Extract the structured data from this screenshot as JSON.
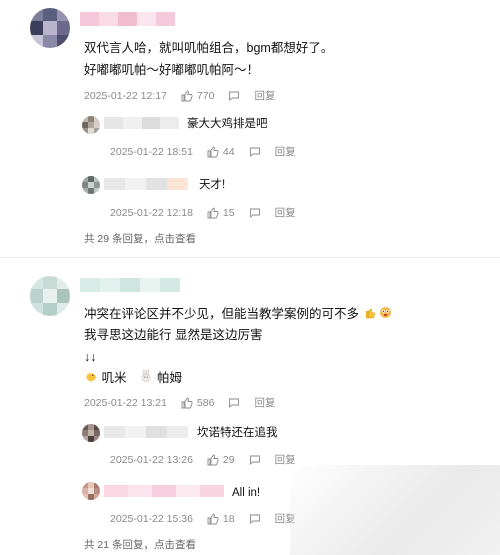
{
  "comments": [
    {
      "text_lines": [
        "双代言人哈，就叫叽帕组合，bgm都想好了。",
        "好嘟嘟叽帕～好嘟嘟叽帕阿～！"
      ],
      "date": "2025-01-22 12:17",
      "likes": "770",
      "reply_label": "回复",
      "replies": [
        {
          "text": "豪大大鸡排是吧",
          "date": "2025-01-22 18:51",
          "likes": "44",
          "reply_label": "回复"
        },
        {
          "text": "天才!",
          "date": "2025-01-22 12:18",
          "likes": "15",
          "reply_label": "回复"
        }
      ],
      "more_replies": "共 29 条回复，点击查看"
    },
    {
      "text_lines": [
        "冲突在评论区并不少见，但能当教学案例的可不多",
        "我寻思这边能行 显然是这边厉害",
        "↓↓"
      ],
      "emoji_line": {
        "a": "叽米",
        "b": "帕姆"
      },
      "date": "2025-01-22 13:21",
      "likes": "586",
      "reply_label": "回复",
      "replies": [
        {
          "text": "坎诺特还在追我",
          "date": "2025-01-22 13:26",
          "likes": "29",
          "reply_label": "回复"
        },
        {
          "text": "All in!",
          "date": "2025-01-22 15:36",
          "likes": "18",
          "reply_label": "回复"
        }
      ],
      "more_replies": "共 21 条回复，点击查看"
    }
  ],
  "icons": {
    "like": "thumbs-up-icon",
    "comment": "comment-bubble-icon"
  },
  "colors": {
    "meta": "#8a8a8a",
    "text": "#111111",
    "divider": "#ececec"
  }
}
